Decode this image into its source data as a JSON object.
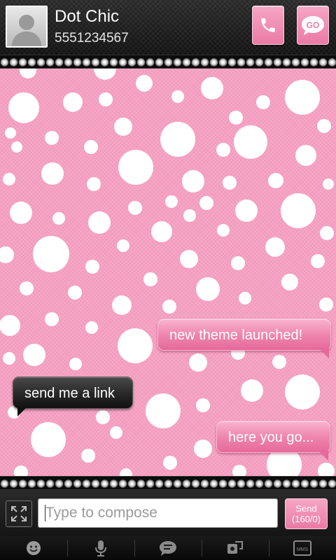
{
  "header": {
    "contact_name": "Dot Chic",
    "contact_number": "5551234567",
    "go_label": "GO"
  },
  "messages": [
    {
      "direction": "outgoing",
      "text": "new theme launched!"
    },
    {
      "direction": "incoming",
      "text": "send me a link"
    },
    {
      "direction": "outgoing",
      "text": "here you go..."
    }
  ],
  "compose": {
    "placeholder": "Type to compose",
    "send_label": "Send",
    "char_counter": "(160/0)"
  },
  "toolbar": {
    "items": [
      "emoji-icon",
      "microphone-icon",
      "go-chat-icon",
      "attach-icon",
      "mms-icon"
    ],
    "mms_label": "MMS"
  },
  "theme": {
    "accent": "#ef86ae",
    "background_pink": "#f39bbe",
    "dot_color": "#ffffff",
    "dark_bubble": "#2a2a2a"
  }
}
